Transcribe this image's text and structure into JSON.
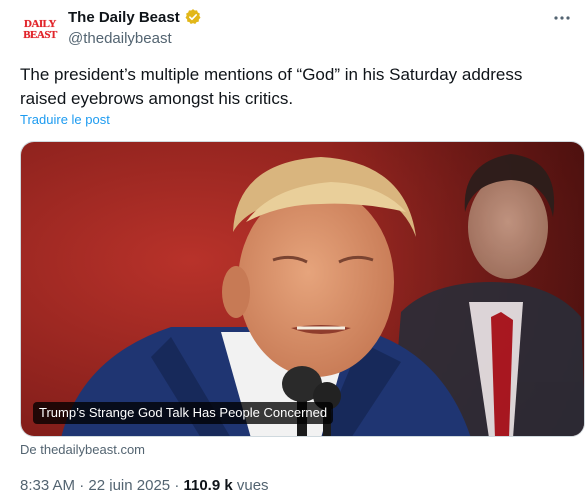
{
  "account": {
    "avatar_line1": "DAILY",
    "avatar_line2": "BEAST",
    "display_name": "The Daily Beast",
    "handle": "@thedailybeast"
  },
  "tweet": {
    "text": "The president’s multiple mentions of “God” in his Saturday address raised eyebrows amongst his critics.",
    "translate_label": "Traduire le post"
  },
  "card": {
    "title": "Trump’s Strange God Talk Has People Concerned",
    "source": "De thedailybeast.com"
  },
  "meta": {
    "time": "8:33 AM",
    "date": "22 juin 2025",
    "separator": "·",
    "views_count": "110.9 k",
    "views_label": "vues"
  },
  "icons": {
    "verified": "verified-gold-badge-icon",
    "more": "more-options-icon"
  },
  "colors": {
    "verified_gold": "#e2b719",
    "link_blue": "#1d9bf0",
    "brand_red": "#e1242a"
  }
}
